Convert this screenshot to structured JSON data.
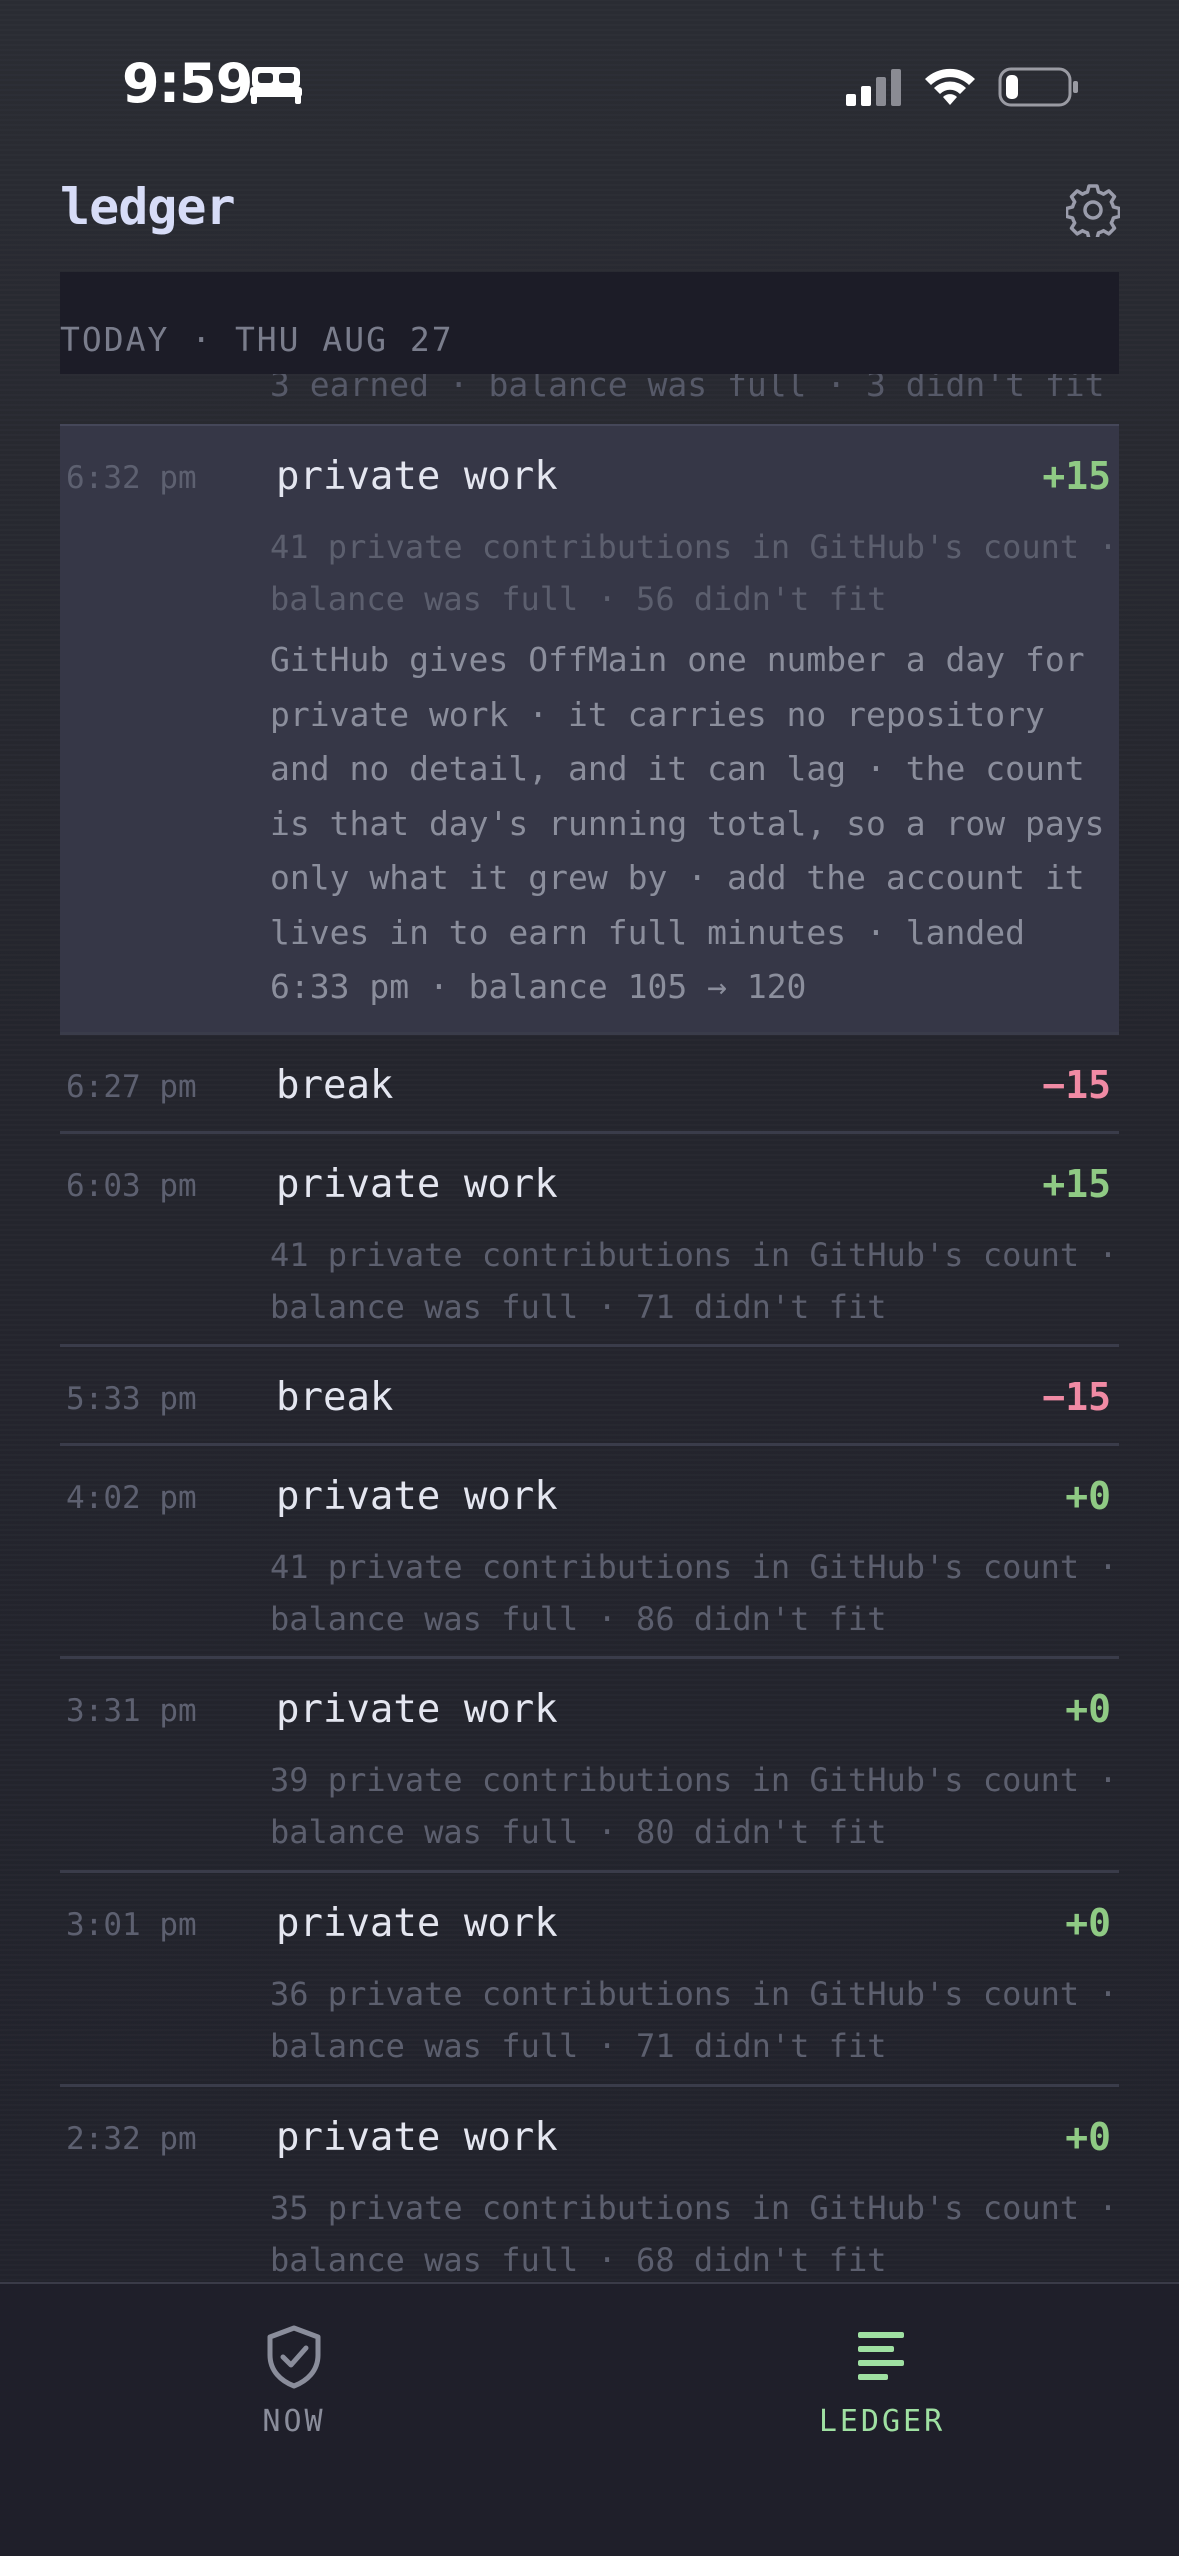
{
  "status_bar": {
    "time": "9:59",
    "icons": [
      "bed-icon",
      "cellular-signal-icon",
      "wifi-icon",
      "battery-icon"
    ]
  },
  "header": {
    "title": "ledger",
    "settings_icon": "gear-icon"
  },
  "day_header": "TODAY · THU AUG 27",
  "partial_previous_line": "3 earned · balance was full · 3 didn't fit",
  "entries": [
    {
      "time": "6:32 pm",
      "label": "private work",
      "amount": "+15",
      "meta": "41 private contributions in GitHub's count · balance was full · 56 didn't fit",
      "note": "GitHub gives OffMain one number a day for private work · it carries no repository and no detail, and it can lag · the count is that day's running total, so a row pays only what it grew by · add the account it lives in to earn full minutes · landed 6:33 pm · balance 105 → 120"
    },
    {
      "time": "6:27 pm",
      "label": "break",
      "amount": "−15"
    },
    {
      "time": "6:03 pm",
      "label": "private work",
      "amount": "+15",
      "meta": "41 private contributions in GitHub's count · balance was full · 71 didn't fit"
    },
    {
      "time": "5:33 pm",
      "label": "break",
      "amount": "−15"
    },
    {
      "time": "4:02 pm",
      "label": "private work",
      "amount": "+0",
      "meta": "41 private contributions in GitHub's count · balance was full · 86 didn't fit"
    },
    {
      "time": "3:31 pm",
      "label": "private work",
      "amount": "+0",
      "meta": "39 private contributions in GitHub's count · balance was full · 80 didn't fit"
    },
    {
      "time": "3:01 pm",
      "label": "private work",
      "amount": "+0",
      "meta": "36 private contributions in GitHub's count · balance was full · 71 didn't fit"
    },
    {
      "time": "2:32 pm",
      "label": "private work",
      "amount": "+0",
      "meta": "35 private contributions in GitHub's count · balance was full · 68 didn't fit"
    }
  ],
  "tabs": [
    {
      "label": "NOW",
      "icon": "shield-check-icon",
      "active": false
    },
    {
      "label": "LEDGER",
      "icon": "list-lines-icon",
      "active": true
    }
  ],
  "colors": {
    "positive": "#8fca84",
    "negative": "#f08aa4",
    "active_tab": "#9fe0a2"
  }
}
